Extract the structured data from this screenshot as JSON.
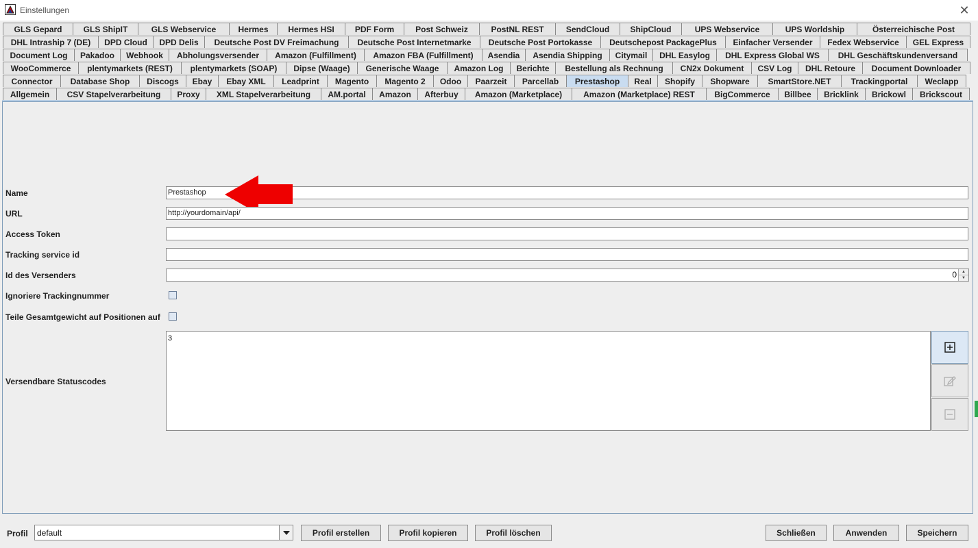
{
  "window": {
    "title": "Einstellungen"
  },
  "tab_rows": [
    [
      "GLS Gepard",
      "GLS ShipIT",
      "GLS Webservice",
      "Hermes",
      "Hermes HSI",
      "PDF Form",
      "Post Schweiz",
      "PostNL REST",
      "SendCloud",
      "ShipCloud",
      "UPS Webservice",
      "UPS Worldship",
      "Österreichische Post"
    ],
    [
      "DHL Intraship 7 (DE)",
      "DPD Cloud",
      "DPD Delis",
      "Deutsche Post DV Freimachung",
      "Deutsche Post Internetmarke",
      "Deutsche Post Portokasse",
      "Deutschepost PackagePlus",
      "Einfacher Versender",
      "Fedex Webservice",
      "GEL Express"
    ],
    [
      "Document Log",
      "Pakadoo",
      "Webhook",
      "Abholungsversender",
      "Amazon (Fulfillment)",
      "Amazon FBA (Fulfillment)",
      "Asendia",
      "Asendia Shipping",
      "Citymail",
      "DHL Easylog",
      "DHL Express Global WS",
      "DHL Geschäftskundenversand"
    ],
    [
      "WooCommerce",
      "plentymarkets (REST)",
      "plentymarkets (SOAP)",
      "Dipse (Waage)",
      "Generische Waage",
      "Amazon Log",
      "Berichte",
      "Bestellung als Rechnung",
      "CN2x Dokument",
      "CSV Log",
      "DHL Retoure",
      "Document Downloader"
    ],
    [
      "Connector",
      "Database Shop",
      "Discogs",
      "Ebay",
      "Ebay XML",
      "Leadprint",
      "Magento",
      "Magento 2",
      "Odoo",
      "Paarzeit",
      "Parcellab",
      "Prestashop",
      "Real",
      "Shopify",
      "Shopware",
      "SmartStore.NET",
      "Trackingportal",
      "Weclapp"
    ],
    [
      "Allgemein",
      "CSV Stapelverarbeitung",
      "Proxy",
      "XML Stapelverarbeitung",
      "AM.portal",
      "Amazon",
      "Afterbuy",
      "Amazon (Marketplace)",
      "Amazon (Marketplace) REST",
      "BigCommerce",
      "Billbee",
      "Bricklink",
      "Brickowl",
      "Brickscout"
    ]
  ],
  "selected_tab": "Prestashop",
  "form": {
    "name_label": "Name",
    "name_value": "Prestashop",
    "url_label": "URL",
    "url_value": "http://yourdomain/api/",
    "token_label": "Access Token",
    "token_value": "",
    "tracking_label": "Tracking service id",
    "tracking_value": "",
    "versender_label": "Id des Versenders",
    "versender_value": "0",
    "ignore_label": "Ignoriere Trackingnummer",
    "ignore_checked": false,
    "split_label": "Teile Gesamtgewicht auf Positionen auf",
    "split_checked": false,
    "status_label": "Versendbare Statuscodes",
    "status_value": "3"
  },
  "footer": {
    "profil_label": "Profil",
    "profil_value": "default",
    "create_label": "Profil erstellen",
    "copy_label": "Profil kopieren",
    "delete_label": "Profil löschen",
    "close_label": "Schließen",
    "apply_label": "Anwenden",
    "save_label": "Speichern"
  },
  "colors": {
    "arrow": "#ee0000",
    "selected_tab": "#c9dcf0",
    "panel_border": "#7f9db9"
  }
}
